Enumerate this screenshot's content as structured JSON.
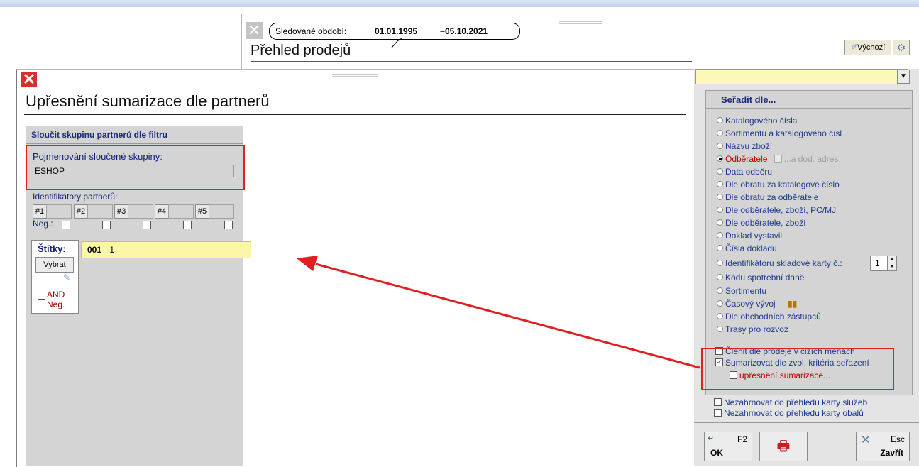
{
  "bg_window": {
    "period_label": "Sledované období:",
    "period_from": "01.01.1995",
    "period_to": "−05.10.2021",
    "title": "Přehled prodejů",
    "default_button": "Výchozí"
  },
  "dialog": {
    "title": "Upřesnění sumarizace dle partnerů"
  },
  "left_panel": {
    "header": "Sloučit skupinu partnerů dle filtru",
    "group_name_label": "Pojmenování sloučené skupiny:",
    "group_name_value": "ESHOP",
    "partner_ids_label": "Identifikátory partnerů:",
    "id_buttons": [
      "#1",
      "#2",
      "#3",
      "#4",
      "#5"
    ],
    "neg_label": "Neg.:",
    "tags_label": "Štítky:",
    "select_button": "Vybrat",
    "and_label": "AND",
    "neg2_label": "Neg.",
    "tag_code": "001",
    "tag_value": "1"
  },
  "sort_panel": {
    "header": "Seřadit dle...",
    "options": [
      "Katalogového čísla",
      "Sortimentu a katalogového čísl",
      "Názvu zboží",
      "Odběratele",
      "Data odběru",
      "Dle obratu za katalogové číslo",
      "Dle obratu za odběratele",
      "Dle odběratele, zboží, PC/MJ",
      "Dle odběratele, zboží",
      "Doklad vystavil",
      "Čísla dokladu",
      "Identifikátoru skladové karty č.:",
      "Kódu spotřební daně",
      "Sortimentu",
      "Časový vývoj",
      "Dle obchodních zástupců",
      "Trasy pro rozvoz"
    ],
    "selected_index": 3,
    "extra_addr_label": "...a dod. adres",
    "id_card_value": "1",
    "split_currency": "Členit dle prodeje v cizích měnách",
    "summarize": "Sumarizovat dle zvol. kritéria seřazení",
    "refine_summary": "upřesnění sumarizace...",
    "exclude_services": "Nezahrnovat do přehledu karty služeb",
    "exclude_packaging": "Nezahrnovat do přehledu karty obalů"
  },
  "buttons": {
    "ok_key": "F2",
    "ok_label": "OK",
    "close_key": "Esc",
    "close_label": "Zavřít"
  }
}
